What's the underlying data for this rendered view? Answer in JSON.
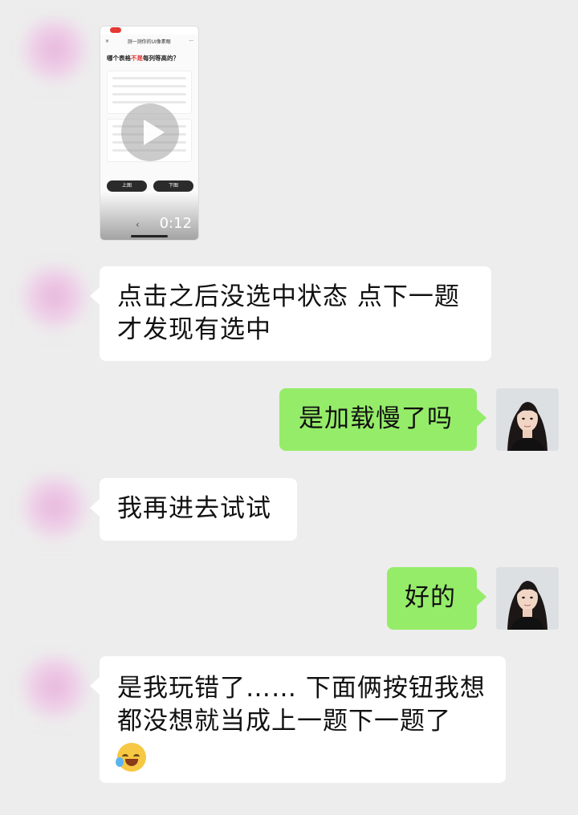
{
  "video": {
    "nav_title": "测一测你的UI像素眼",
    "question_prefix": "哪个表格",
    "question_highlight": "不是",
    "question_suffix": "每列等高的？",
    "prev_button": "上图",
    "next_button": "下图",
    "duration": "0:12",
    "back_glyph": "‹",
    "close_glyph": "×",
    "more_glyph": "···"
  },
  "messages": [
    {
      "side": "in",
      "text": "点击之后没选中状态 点下一题才发现有选中"
    },
    {
      "side": "out",
      "text": "是加载慢了吗"
    },
    {
      "side": "in",
      "text": "我再进去试试"
    },
    {
      "side": "out",
      "text": "好的"
    },
    {
      "side": "in",
      "text": "是我玩错了…… 下面俩按钮我想都没想就当成上一题下一题了",
      "emoji": "face-with-tears-of-joy-emoji"
    }
  ],
  "colors": {
    "background": "#ededed",
    "incoming_bubble": "#ffffff",
    "outgoing_bubble": "#95ec69",
    "highlight_red": "#e53935"
  }
}
